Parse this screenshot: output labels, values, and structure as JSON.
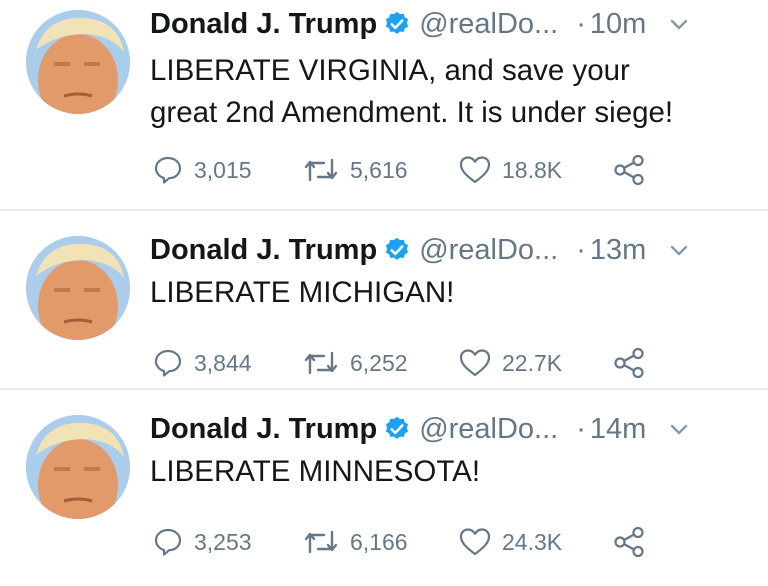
{
  "colors": {
    "text": "#14171a",
    "secondary": "#657786",
    "verified_badge": "#1da1f2",
    "divider": "#e6ecf0"
  },
  "icons": {
    "verified": "verified-badge-icon",
    "caret": "chevron-down-icon",
    "reply": "reply-icon",
    "retweet": "retweet-icon",
    "like": "heart-icon",
    "share": "share-icon"
  },
  "tweets": [
    {
      "name": "Donald J. Trump",
      "handle": "@realDo...",
      "dot": "·",
      "time": "10m",
      "lines": [
        "LIBERATE VIRGINIA, and save your",
        "great 2nd Amendment. It is under siege!"
      ],
      "replies": "3,015",
      "retweets": "5,616",
      "likes": "18.8K"
    },
    {
      "name": "Donald J. Trump",
      "handle": "@realDo...",
      "dot": "·",
      "time": "13m",
      "lines": [
        "LIBERATE MICHIGAN!"
      ],
      "replies": "3,844",
      "retweets": "6,252",
      "likes": "22.7K"
    },
    {
      "name": "Donald J. Trump",
      "handle": "@realDo...",
      "dot": "·",
      "time": "14m",
      "lines": [
        "LIBERATE MINNESOTA!"
      ],
      "replies": "3,253",
      "retweets": "6,166",
      "likes": "24.3K"
    }
  ]
}
